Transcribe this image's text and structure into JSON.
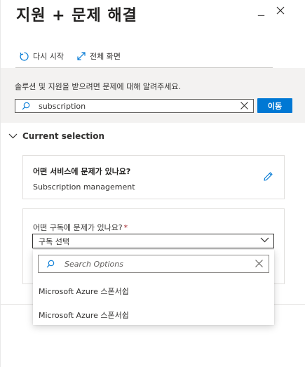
{
  "window": {
    "title": "지원 + 문제 해결",
    "minimize_label": "_"
  },
  "toolbar": {
    "restart_label": "다시 시작",
    "fullscreen_label": "전체 화면"
  },
  "search": {
    "prompt": "솔루션 및 지원을 받으려면 문제에 대해 알려주세요.",
    "value": "subscription",
    "go_label": "이동"
  },
  "selection": {
    "header": "Current selection",
    "service_question": "어떤 서비스에 문제가 있나요?",
    "service_value": "Subscription management",
    "subscription_question": "어떤 구독에 문제가 있나요?",
    "required_marker": "*",
    "subscription_selected": "구독 선택"
  },
  "dropdown": {
    "search_placeholder": "Search Options",
    "options": [
      "Microsoft Azure 스폰서쉽",
      "Microsoft Azure 스폰서쉽"
    ]
  },
  "colors": {
    "accent": "#0078d4",
    "band": "#f3f2f1",
    "required": "#a4262c"
  },
  "icons": {
    "close": "close-icon",
    "restart": "refresh-icon",
    "fullscreen": "expand-icon",
    "search": "search-icon",
    "clear": "clear-icon",
    "collapse": "chevron-down-icon",
    "edit": "pencil-icon",
    "select": "chevron-down-icon"
  }
}
